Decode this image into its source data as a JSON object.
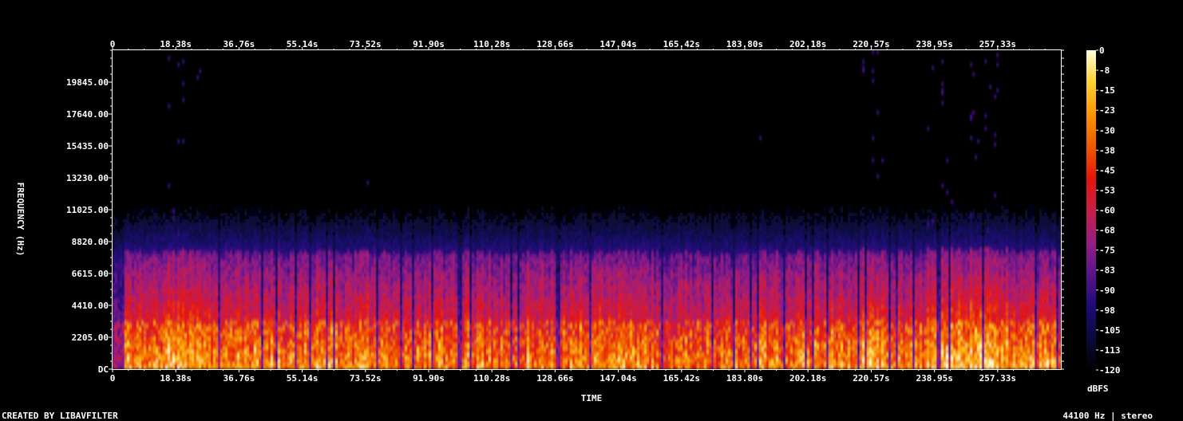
{
  "footer": {
    "left": "CREATED BY LIBAVFILTER",
    "right": "44100 Hz | stereo"
  },
  "colors": {
    "background": "#000000",
    "axis": "#ffffff",
    "gradient_stops": [
      "#000000",
      "#0a0a3c",
      "#1e0a78",
      "#5a148c",
      "#961e82",
      "#c81e46",
      "#e6140a",
      "#f05a00",
      "#fa9600",
      "#ffd232",
      "#ffffdc"
    ]
  },
  "chart_data": {
    "type": "heatmap",
    "title": "",
    "xlabel": "TIME",
    "ylabel": "FREQUENCY (Hz)",
    "colorbar_label": "dBFS",
    "x_ticks": [
      "0",
      "18.38s",
      "36.76s",
      "55.14s",
      "73.52s",
      "91.90s",
      "110.28s",
      "128.66s",
      "147.04s",
      "165.42s",
      "183.80s",
      "202.18s",
      "220.57s",
      "238.95s",
      "257.33s"
    ],
    "x_tick_values": [
      0,
      18.38,
      36.76,
      55.14,
      73.52,
      91.9,
      110.28,
      128.66,
      147.04,
      165.42,
      183.8,
      202.18,
      220.57,
      238.95,
      257.33
    ],
    "xlim": [
      0,
      275.7
    ],
    "y_ticks": [
      "DC",
      "2205.00",
      "4410.00",
      "6615.00",
      "8820.00",
      "11025.00",
      "13230.00",
      "15435.00",
      "17640.00",
      "19845.00"
    ],
    "y_tick_values": [
      0,
      2205,
      4410,
      6615,
      8820,
      11025,
      13230,
      15435,
      17640,
      19845
    ],
    "ylim": [
      0,
      22050
    ],
    "colorbar_ticks": [
      "0",
      "-8",
      "-15",
      "-23",
      "-30",
      "-38",
      "-45",
      "-53",
      "-60",
      "-68",
      "-75",
      "-83",
      "-90",
      "-98",
      "-105",
      "-113",
      "-120"
    ],
    "colorbar_range": [
      -120,
      0
    ]
  }
}
